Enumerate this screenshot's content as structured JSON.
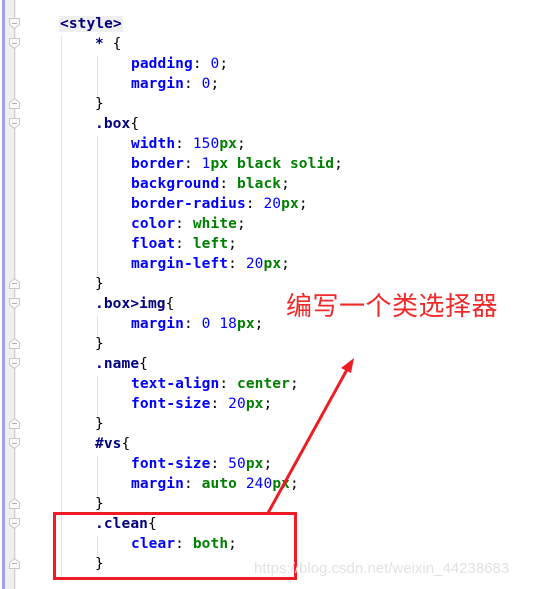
{
  "editor": {
    "language": "css",
    "lines": [
      {
        "indent": 0,
        "tokens": [
          {
            "t": "tag",
            "v": "<style>"
          }
        ]
      },
      {
        "indent": 1,
        "tokens": [
          {
            "t": "sel",
            "v": "* "
          },
          {
            "t": "punct",
            "v": "{"
          }
        ]
      },
      {
        "indent": 2,
        "tokens": [
          {
            "t": "prop",
            "v": "padding"
          },
          {
            "t": "punct",
            "v": ": "
          },
          {
            "t": "num",
            "v": "0"
          },
          {
            "t": "punct",
            "v": ";"
          }
        ]
      },
      {
        "indent": 2,
        "tokens": [
          {
            "t": "prop",
            "v": "margin"
          },
          {
            "t": "punct",
            "v": ": "
          },
          {
            "t": "num",
            "v": "0"
          },
          {
            "t": "punct",
            "v": ";"
          }
        ]
      },
      {
        "indent": 1,
        "tokens": [
          {
            "t": "punct",
            "v": "}"
          }
        ]
      },
      {
        "indent": 1,
        "tokens": [
          {
            "t": "sel",
            "v": ".box"
          },
          {
            "t": "punct",
            "v": "{"
          }
        ]
      },
      {
        "indent": 2,
        "tokens": [
          {
            "t": "prop",
            "v": "width"
          },
          {
            "t": "punct",
            "v": ": "
          },
          {
            "t": "num",
            "v": "150"
          },
          {
            "t": "unit",
            "v": "px"
          },
          {
            "t": "punct",
            "v": ";"
          }
        ]
      },
      {
        "indent": 2,
        "tokens": [
          {
            "t": "prop",
            "v": "border"
          },
          {
            "t": "punct",
            "v": ": "
          },
          {
            "t": "num",
            "v": "1"
          },
          {
            "t": "unit",
            "v": "px"
          },
          {
            "t": "kw",
            "v": " black solid"
          },
          {
            "t": "punct",
            "v": ";"
          }
        ]
      },
      {
        "indent": 2,
        "tokens": [
          {
            "t": "prop",
            "v": "background"
          },
          {
            "t": "punct",
            "v": ": "
          },
          {
            "t": "kw",
            "v": "black"
          },
          {
            "t": "punct",
            "v": ";"
          }
        ]
      },
      {
        "indent": 2,
        "tokens": [
          {
            "t": "prop",
            "v": "border-radius"
          },
          {
            "t": "punct",
            "v": ": "
          },
          {
            "t": "num",
            "v": "20"
          },
          {
            "t": "unit",
            "v": "px"
          },
          {
            "t": "punct",
            "v": ";"
          }
        ]
      },
      {
        "indent": 2,
        "tokens": [
          {
            "t": "prop",
            "v": "color"
          },
          {
            "t": "punct",
            "v": ": "
          },
          {
            "t": "kw",
            "v": "white"
          },
          {
            "t": "punct",
            "v": ";"
          }
        ]
      },
      {
        "indent": 2,
        "tokens": [
          {
            "t": "prop",
            "v": "float"
          },
          {
            "t": "punct",
            "v": ": "
          },
          {
            "t": "kw",
            "v": "left"
          },
          {
            "t": "punct",
            "v": ";"
          }
        ]
      },
      {
        "indent": 2,
        "tokens": [
          {
            "t": "prop",
            "v": "margin-left"
          },
          {
            "t": "punct",
            "v": ": "
          },
          {
            "t": "num",
            "v": "20"
          },
          {
            "t": "unit",
            "v": "px"
          },
          {
            "t": "punct",
            "v": ";"
          }
        ]
      },
      {
        "indent": 1,
        "tokens": [
          {
            "t": "punct",
            "v": "}"
          }
        ]
      },
      {
        "indent": 1,
        "tokens": [
          {
            "t": "sel",
            "v": ".box>img"
          },
          {
            "t": "punct",
            "v": "{"
          }
        ]
      },
      {
        "indent": 2,
        "tokens": [
          {
            "t": "prop",
            "v": "margin"
          },
          {
            "t": "punct",
            "v": ": "
          },
          {
            "t": "num",
            "v": "0 18"
          },
          {
            "t": "unit",
            "v": "px"
          },
          {
            "t": "punct",
            "v": ";"
          }
        ]
      },
      {
        "indent": 1,
        "tokens": [
          {
            "t": "punct",
            "v": "}"
          }
        ]
      },
      {
        "indent": 1,
        "tokens": [
          {
            "t": "sel",
            "v": ".name"
          },
          {
            "t": "punct",
            "v": "{"
          }
        ]
      },
      {
        "indent": 2,
        "tokens": [
          {
            "t": "prop",
            "v": "text-align"
          },
          {
            "t": "punct",
            "v": ": "
          },
          {
            "t": "kw",
            "v": "center"
          },
          {
            "t": "punct",
            "v": ";"
          }
        ]
      },
      {
        "indent": 2,
        "tokens": [
          {
            "t": "prop",
            "v": "font-size"
          },
          {
            "t": "punct",
            "v": ": "
          },
          {
            "t": "num",
            "v": "20"
          },
          {
            "t": "unit",
            "v": "px"
          },
          {
            "t": "punct",
            "v": ";"
          }
        ]
      },
      {
        "indent": 1,
        "tokens": [
          {
            "t": "punct",
            "v": "}"
          }
        ]
      },
      {
        "indent": 1,
        "tokens": [
          {
            "t": "sel",
            "v": "#vs"
          },
          {
            "t": "punct",
            "v": "{"
          }
        ]
      },
      {
        "indent": 2,
        "tokens": [
          {
            "t": "prop",
            "v": "font-size"
          },
          {
            "t": "punct",
            "v": ": "
          },
          {
            "t": "num",
            "v": "50"
          },
          {
            "t": "unit",
            "v": "px"
          },
          {
            "t": "punct",
            "v": ";"
          }
        ]
      },
      {
        "indent": 2,
        "tokens": [
          {
            "t": "prop",
            "v": "margin"
          },
          {
            "t": "punct",
            "v": ": "
          },
          {
            "t": "kw",
            "v": "auto "
          },
          {
            "t": "num",
            "v": "240"
          },
          {
            "t": "unit",
            "v": "px"
          },
          {
            "t": "punct",
            "v": ";"
          }
        ]
      },
      {
        "indent": 1,
        "tokens": [
          {
            "t": "punct",
            "v": "}"
          }
        ]
      },
      {
        "indent": 1,
        "tokens": [
          {
            "t": "sel",
            "v": ".clean"
          },
          {
            "t": "punct",
            "v": "{"
          }
        ]
      },
      {
        "indent": 2,
        "tokens": [
          {
            "t": "prop",
            "v": "clear"
          },
          {
            "t": "punct",
            "v": ": "
          },
          {
            "t": "kw",
            "v": "both"
          },
          {
            "t": "punct",
            "v": ";"
          }
        ]
      },
      {
        "indent": 1,
        "tokens": [
          {
            "t": "punct",
            "v": "}"
          }
        ]
      }
    ],
    "fold_markers": [
      {
        "line": 0,
        "type": "open"
      },
      {
        "line": 1,
        "type": "open"
      },
      {
        "line": 4,
        "type": "close"
      },
      {
        "line": 5,
        "type": "open"
      },
      {
        "line": 13,
        "type": "close"
      },
      {
        "line": 14,
        "type": "open"
      },
      {
        "line": 16,
        "type": "close"
      },
      {
        "line": 17,
        "type": "open"
      },
      {
        "line": 20,
        "type": "close"
      },
      {
        "line": 21,
        "type": "open"
      },
      {
        "line": 24,
        "type": "close"
      },
      {
        "line": 25,
        "type": "open"
      },
      {
        "line": 27,
        "type": "close"
      }
    ]
  },
  "annotation": {
    "text": "编写一个类选择器",
    "color": "#ee2a2a",
    "highlighted_line_range": [
      25,
      27
    ]
  },
  "watermark": {
    "text": "https://blog.csdn.net/weixin_44238683"
  }
}
